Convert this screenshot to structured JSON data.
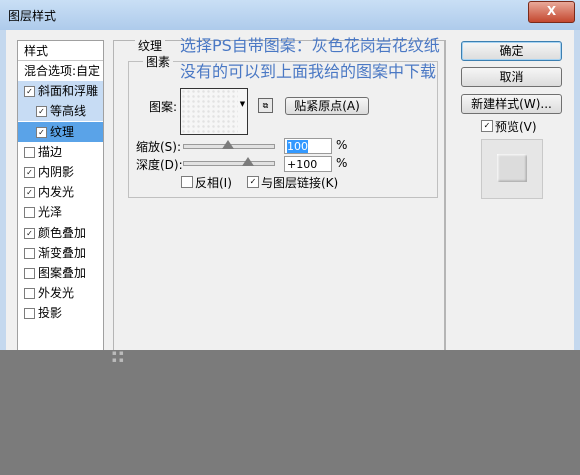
{
  "window": {
    "title": "图层样式",
    "close_label": "X"
  },
  "left_panel": {
    "header": "样式",
    "items": [
      {
        "label": "混合选项:自定",
        "checkbox": false,
        "checked": false
      },
      {
        "label": "斜面和浮雕",
        "checkbox": true,
        "checked": true
      },
      {
        "label": "等高线",
        "checkbox": true,
        "checked": true
      },
      {
        "label": "纹理",
        "checkbox": true,
        "checked": true
      },
      {
        "label": "描边",
        "checkbox": true,
        "checked": false
      },
      {
        "label": "内阴影",
        "checkbox": true,
        "checked": true
      },
      {
        "label": "内发光",
        "checkbox": true,
        "checked": true
      },
      {
        "label": "光泽",
        "checkbox": true,
        "checked": false
      },
      {
        "label": "颜色叠加",
        "checkbox": true,
        "checked": true
      },
      {
        "label": "渐变叠加",
        "checkbox": true,
        "checked": false
      },
      {
        "label": "图案叠加",
        "checkbox": true,
        "checked": false
      },
      {
        "label": "外发光",
        "checkbox": true,
        "checked": false
      },
      {
        "label": "投影",
        "checkbox": true,
        "checked": false
      }
    ]
  },
  "texture": {
    "section_title": "纹理",
    "group_title": "图素",
    "pattern_label": "图案:",
    "snap_button": "贴紧原点(A)",
    "scale_label": "缩放(S):",
    "scale_value": "100",
    "scale_unit": "%",
    "depth_label": "深度(D):",
    "depth_value": "+100",
    "depth_unit": "%",
    "invert_label": "反相(I)",
    "invert_checked": false,
    "link_label": "与图层链接(K)",
    "link_checked": true,
    "scale_fraction": 0.5,
    "depth_fraction": 0.72
  },
  "right_panel": {
    "ok": "确定",
    "cancel": "取消",
    "new_style": "新建样式(W)...",
    "preview_label": "预览(V)",
    "preview_checked": true
  },
  "overlay_text": {
    "line1": "选择PS自带图案：灰色花岗岩花纹纸",
    "line2": "没有的可以到上面我给的图案中下载"
  }
}
